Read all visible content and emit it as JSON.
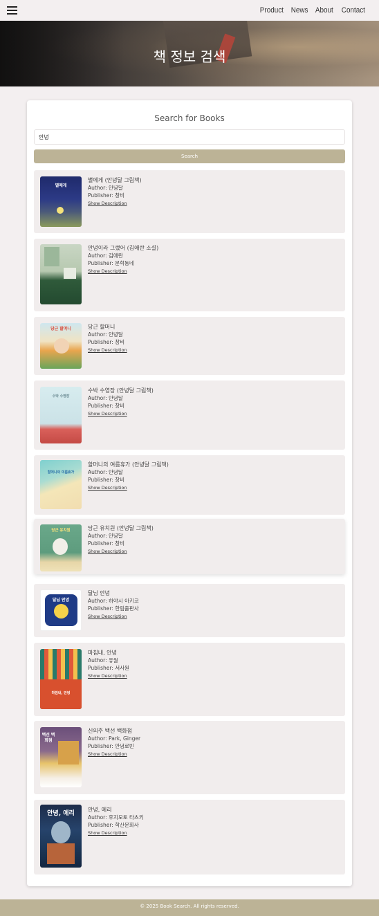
{
  "nav": {
    "menu_icon": "hamburger-menu-icon",
    "links": [
      "Product",
      "News",
      "About",
      "Contact"
    ]
  },
  "hero": {
    "title": "책 정보 검색"
  },
  "search": {
    "heading": "Search for Books",
    "query": "안녕",
    "button_label": "Search"
  },
  "labels": {
    "author": "Author: ",
    "publisher": "Publisher: ",
    "show_description": "Show Description"
  },
  "results": [
    {
      "title": "별에게 (안녕달 그림책)",
      "author": "안녕달",
      "publisher": "창비",
      "cover_text": "별에게"
    },
    {
      "title": "안녕이라 그랬어 (김애란 소설)",
      "author": "김애란",
      "publisher": "문학동네",
      "cover_text": ""
    },
    {
      "title": "당근 할머니",
      "author": "안녕달",
      "publisher": "창비",
      "cover_text": "당근 할머니"
    },
    {
      "title": "수박 수영장 (안녕달 그림책)",
      "author": "안녕달",
      "publisher": "창비",
      "cover_text": "수박 수영장"
    },
    {
      "title": "할머니의 여름휴가 (안녕달 그림책)",
      "author": "안녕달",
      "publisher": "창비",
      "cover_text": "할머니의 여름휴가"
    },
    {
      "title": "당근 유치원 (안녕달 그림책)",
      "author": "안녕달",
      "publisher": "창비",
      "cover_text": "당근 유치원"
    },
    {
      "title": "달님 안녕",
      "author": "하야시 아키코",
      "publisher": "한림출판사",
      "cover_text": "달님 안녕"
    },
    {
      "title": "마침내, 안녕",
      "author": "유월",
      "publisher": "서사원",
      "cover_text": "마침내, 안녕"
    },
    {
      "title": "신의주 백선 백화점",
      "author": "Park, Ginger",
      "publisher": "안녕로빈",
      "cover_text": "백선 백화점"
    },
    {
      "title": "안녕, 에리",
      "author": "후지모토 타츠키",
      "publisher": "학산문화사",
      "cover_text": "안녕, 에리"
    }
  ],
  "footer": {
    "text": "© 2025 Book Search. All rights reserved."
  },
  "colors": {
    "accent": "#bcb396",
    "background": "#f3eff0",
    "card": "#ffffff",
    "result_bg": "#f1eded"
  }
}
